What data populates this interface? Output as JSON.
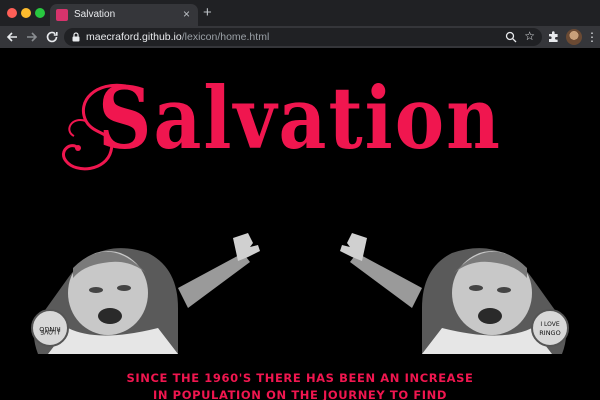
{
  "browser": {
    "tab_title": "Salvation",
    "tab_close": "×",
    "new_tab": "+",
    "url_host": "maecraford.github.io",
    "url_path": "/lexicon/home.html"
  },
  "page": {
    "title": "Salvation",
    "badge_text": "I LOVE RINGO",
    "tagline_line1": "Since the 1960's there has been an increase",
    "tagline_line2": "in population on the journey to find"
  },
  "colors": {
    "accent": "#f0164f",
    "background": "#000000",
    "chrome_dark": "#202124",
    "chrome_mid": "#35363a"
  },
  "icons": [
    "back-icon",
    "forward-icon",
    "reload-icon",
    "lock-icon",
    "zoom-icon",
    "star-icon",
    "extensions-icon",
    "profile-avatar",
    "menu-icon"
  ]
}
